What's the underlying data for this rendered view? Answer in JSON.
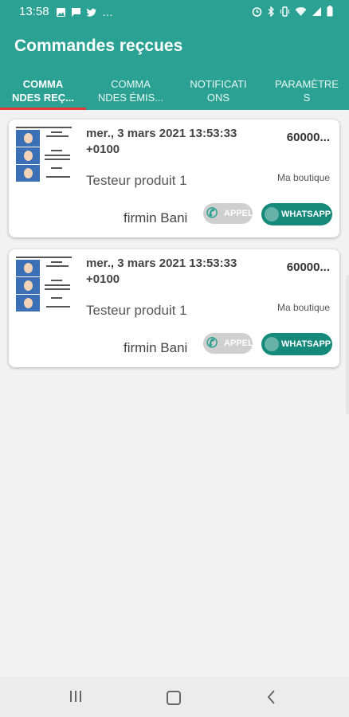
{
  "status_bar": {
    "time": "13:58",
    "overflow": "…",
    "left_icons": [
      "image-icon",
      "message-icon",
      "twitter-icon"
    ],
    "right_icons": [
      "alarm-icon",
      "bluetooth-icon",
      "vibrate-icon",
      "wifi-icon",
      "signal-icon",
      "battery-icon"
    ]
  },
  "app_bar": {
    "title": "Commandes reçcues"
  },
  "tabs": [
    {
      "line1": "COMMA",
      "line2": "NDES REÇ...",
      "active": true
    },
    {
      "line1": "COMMA",
      "line2": "NDES ÉMIS...",
      "active": false
    },
    {
      "line1": "NOTIFICATI",
      "line2": "ONS",
      "active": false
    },
    {
      "line1": "PARAMÈTRE",
      "line2": "S",
      "active": false
    }
  ],
  "orders": [
    {
      "date_line1": "mer., 3 mars 2021 13:53:33",
      "date_line2": "+0100",
      "amount": "60000...",
      "product": "Testeur produit 1",
      "shop": "Ma boutique",
      "customer": "firmin Bani",
      "call_label": "APPEL",
      "whatsapp_label": "WHATSAPP"
    },
    {
      "date_line1": "mer., 3 mars 2021 13:53:33",
      "date_line2": "+0100",
      "amount": "60000...",
      "product": "Testeur produit 1",
      "shop": "Ma boutique",
      "customer": "firmin Bani",
      "call_label": "APPEL",
      "whatsapp_label": "WHATSAPP"
    }
  ],
  "colors": {
    "primary": "#2aa192",
    "whatsapp": "#15897a",
    "tab_indicator": "#e53935",
    "call_button": "#cfcfcf"
  }
}
